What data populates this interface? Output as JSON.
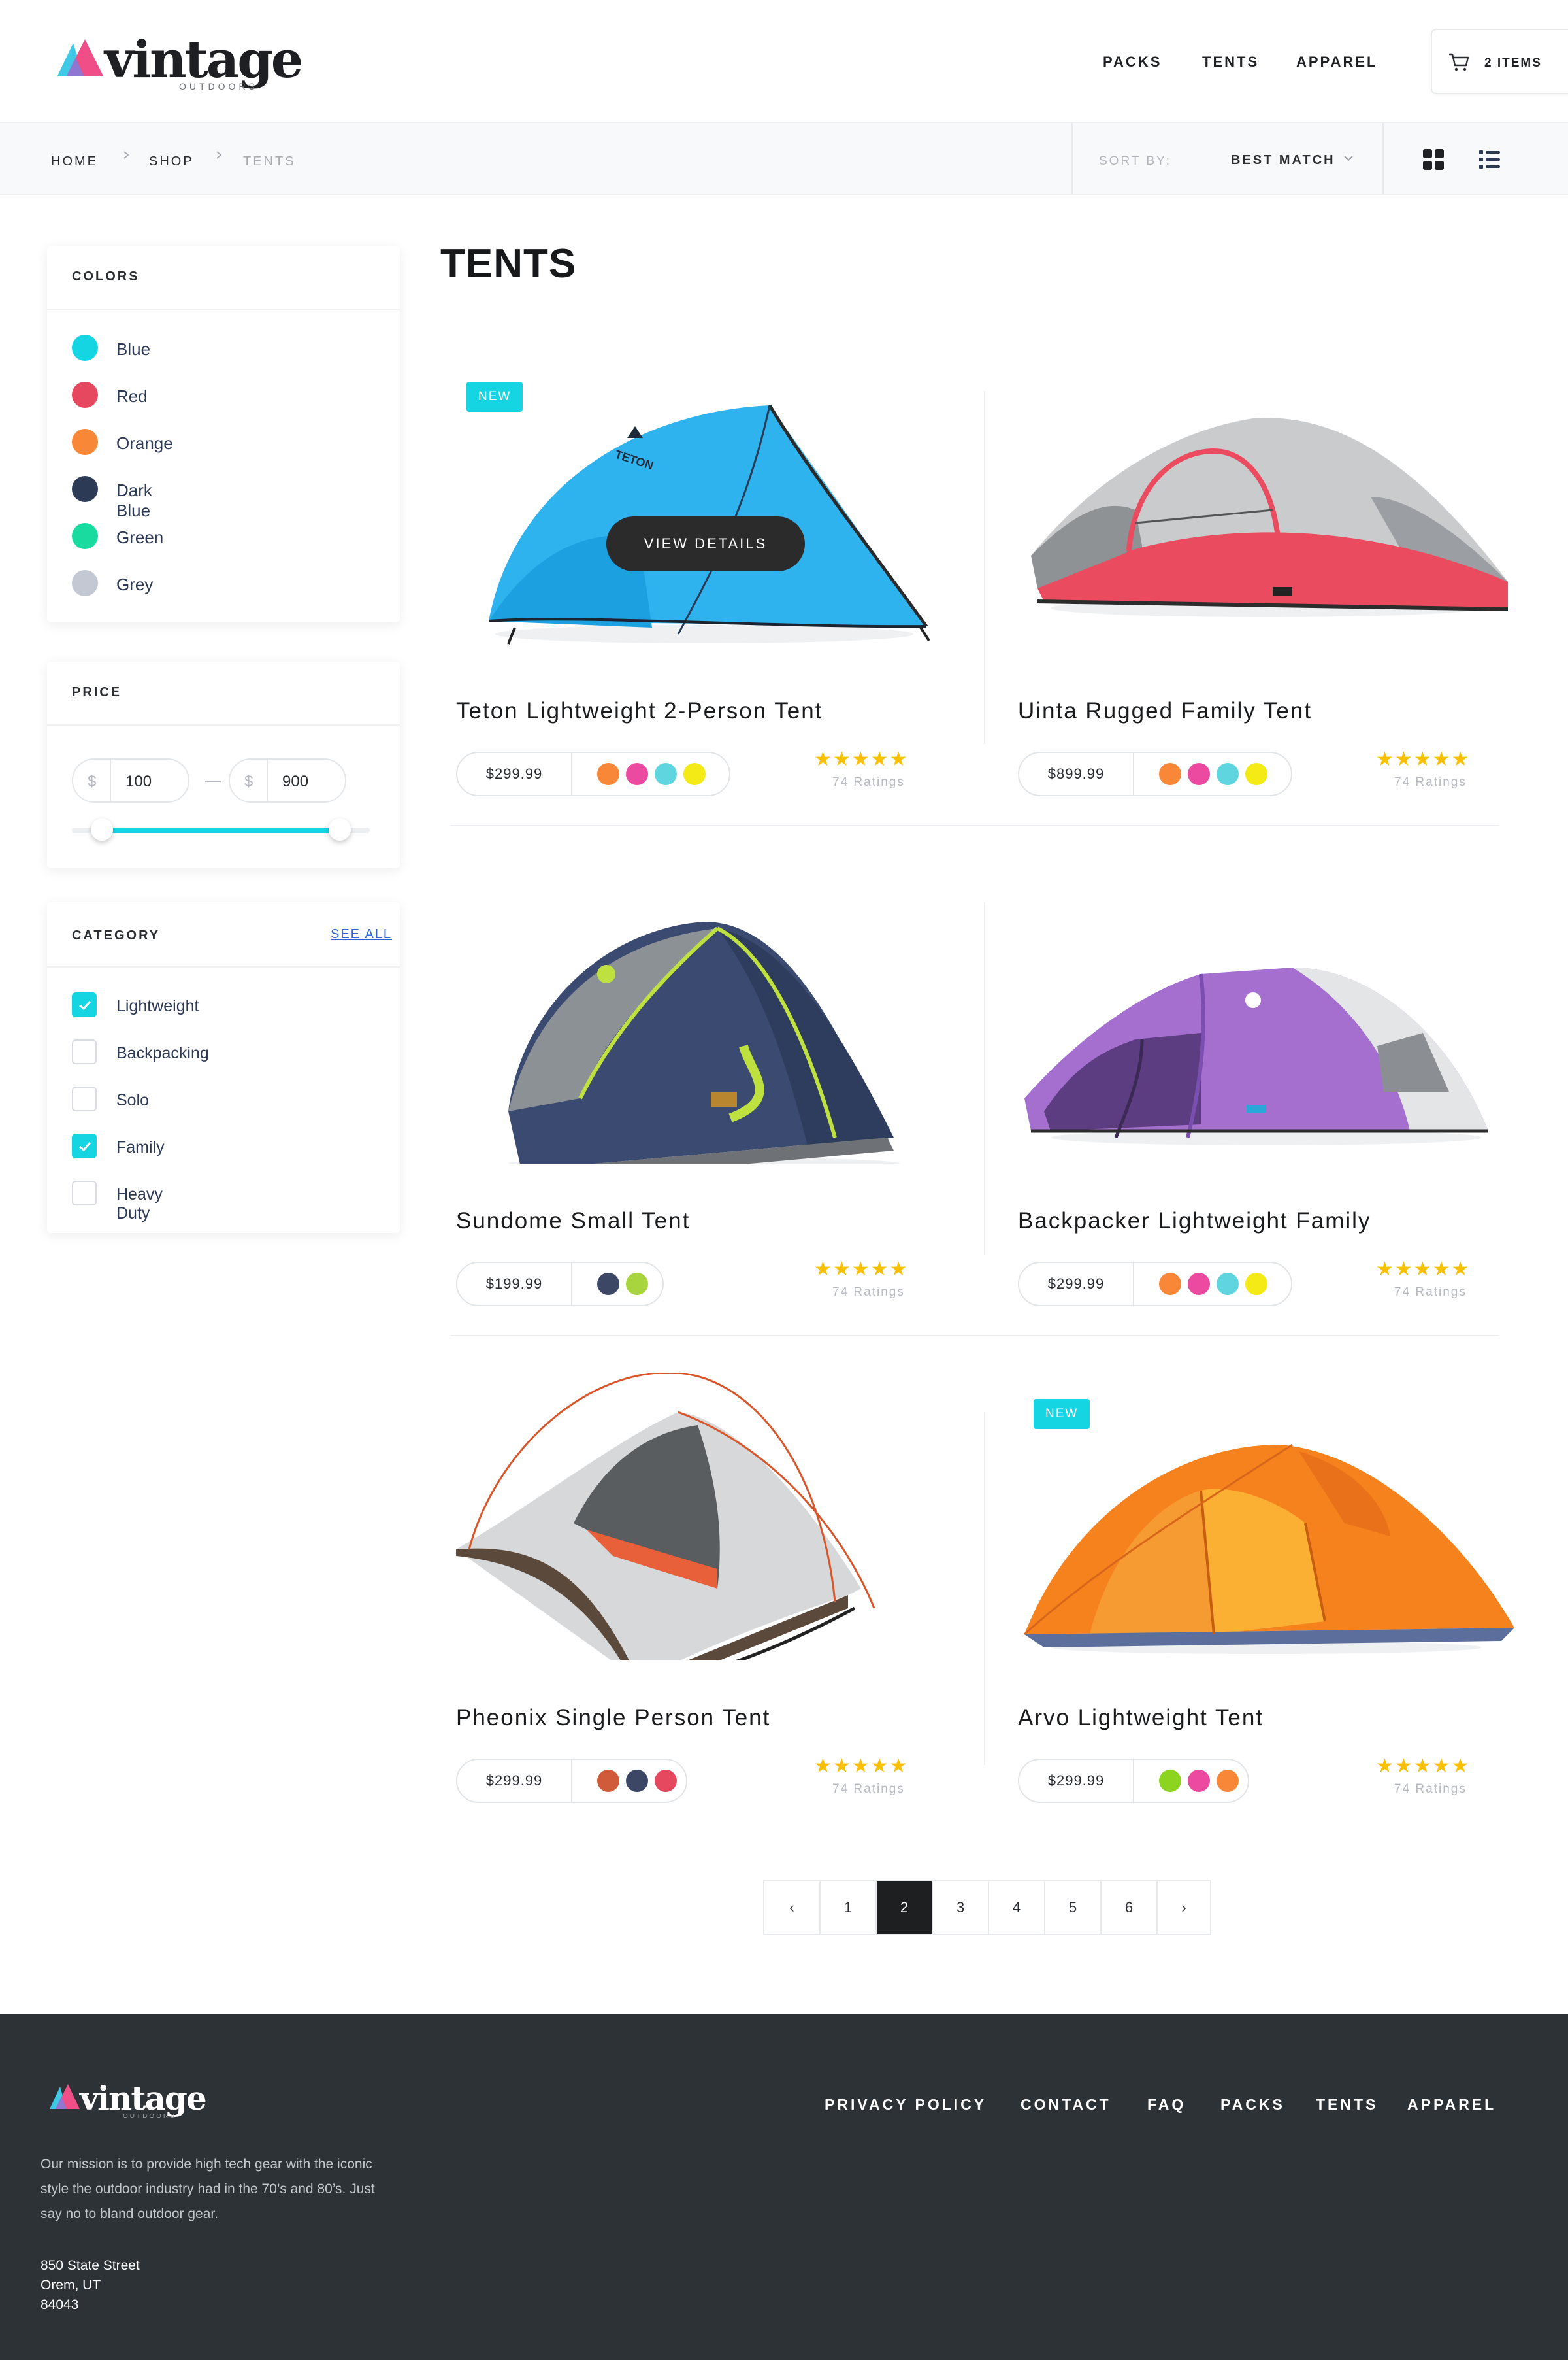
{
  "brand": {
    "name": "vintage",
    "tagline": "OUTDOORS"
  },
  "topnav": [
    "PACKS",
    "TENTS",
    "APPAREL"
  ],
  "cart": {
    "label": "2 ITEMS"
  },
  "breadcrumb": [
    "HOME",
    "SHOP",
    "TENTS"
  ],
  "sort": {
    "label": "SORT BY:",
    "value": "BEST MATCH"
  },
  "sidebar": {
    "colors": {
      "title": "COLORS",
      "items": [
        {
          "name": "Blue",
          "hex": "#16d5e3"
        },
        {
          "name": "Red",
          "hex": "#e6485f"
        },
        {
          "name": "Orange",
          "hex": "#f98738"
        },
        {
          "name": "Dark Blue",
          "hex": "#2d3a55"
        },
        {
          "name": "Green",
          "hex": "#19dba0"
        },
        {
          "name": "Grey",
          "hex": "#c4c8d2"
        }
      ]
    },
    "price": {
      "title": "PRICE",
      "currency": "$",
      "min": "100",
      "max": "900",
      "range_min_fraction": 0.1,
      "range_max_fraction": 0.9
    },
    "category": {
      "title": "CATEGORY",
      "see_all": "SEE ALL",
      "items": [
        {
          "label": "Lightweight",
          "checked": true
        },
        {
          "label": "Backpacking",
          "checked": false
        },
        {
          "label": "Solo",
          "checked": false
        },
        {
          "label": "Family",
          "checked": true
        },
        {
          "label": "Heavy Duty",
          "checked": false
        }
      ]
    }
  },
  "main": {
    "title": "TENTS",
    "view_details": "VIEW DETAILS",
    "products": [
      {
        "name": "Teton Lightweight 2-Person Tent",
        "price": "$299.99",
        "swatches": [
          "#f98738",
          "#ec4aa0",
          "#5fd5e0",
          "#f3ea16"
        ],
        "stars": "★★★★★",
        "ratings": "74 Ratings",
        "badge": "NEW"
      },
      {
        "name": "Uinta Rugged Family Tent",
        "price": "$899.99",
        "swatches": [
          "#f98738",
          "#ec4aa0",
          "#5fd5e0",
          "#f3ea16"
        ],
        "stars": "★★★★★",
        "ratings": "74 Ratings",
        "badge": ""
      },
      {
        "name": "Sundome Small Tent",
        "price": "$199.99",
        "swatches": [
          "#3b4764",
          "#a8d43e"
        ],
        "stars": "★★★★★",
        "ratings": "74 Ratings",
        "badge": ""
      },
      {
        "name": "Backpacker Lightweight Family",
        "price": "$299.99",
        "swatches": [
          "#f98738",
          "#ec4aa0",
          "#5fd5e0",
          "#f3ea16"
        ],
        "stars": "★★★★★",
        "ratings": "74 Ratings",
        "badge": ""
      },
      {
        "name": "Pheonix Single Person Tent",
        "price": "$299.99",
        "swatches": [
          "#cf5b3b",
          "#3b4764",
          "#e6485f"
        ],
        "stars": "★★★★★",
        "ratings": "74 Ratings",
        "badge": ""
      },
      {
        "name": "Arvo Lightweight Tent",
        "price": "$299.99",
        "swatches": [
          "#8dd420",
          "#ec4aa0",
          "#f98738"
        ],
        "stars": "★★★★★",
        "ratings": "74 Ratings",
        "badge": "NEW"
      }
    ]
  },
  "pagination": {
    "prev": "‹",
    "pages": [
      "1",
      "2",
      "3",
      "4",
      "5",
      "6"
    ],
    "active": "2",
    "next": "›"
  },
  "footer": {
    "brand": "vintage",
    "tagline": "OUTDOORS",
    "links": [
      "PRIVACY POLICY",
      "CONTACT",
      "FAQ",
      "PACKS",
      "TENTS",
      "APPAREL"
    ],
    "mission": "Our  mission is to provide high tech gear with the iconic style the outdoor industry had in the 70’s and 80’s. Just say no to bland outdoor gear.",
    "address": [
      "850 State Street",
      "Orem, UT",
      "84043"
    ]
  }
}
